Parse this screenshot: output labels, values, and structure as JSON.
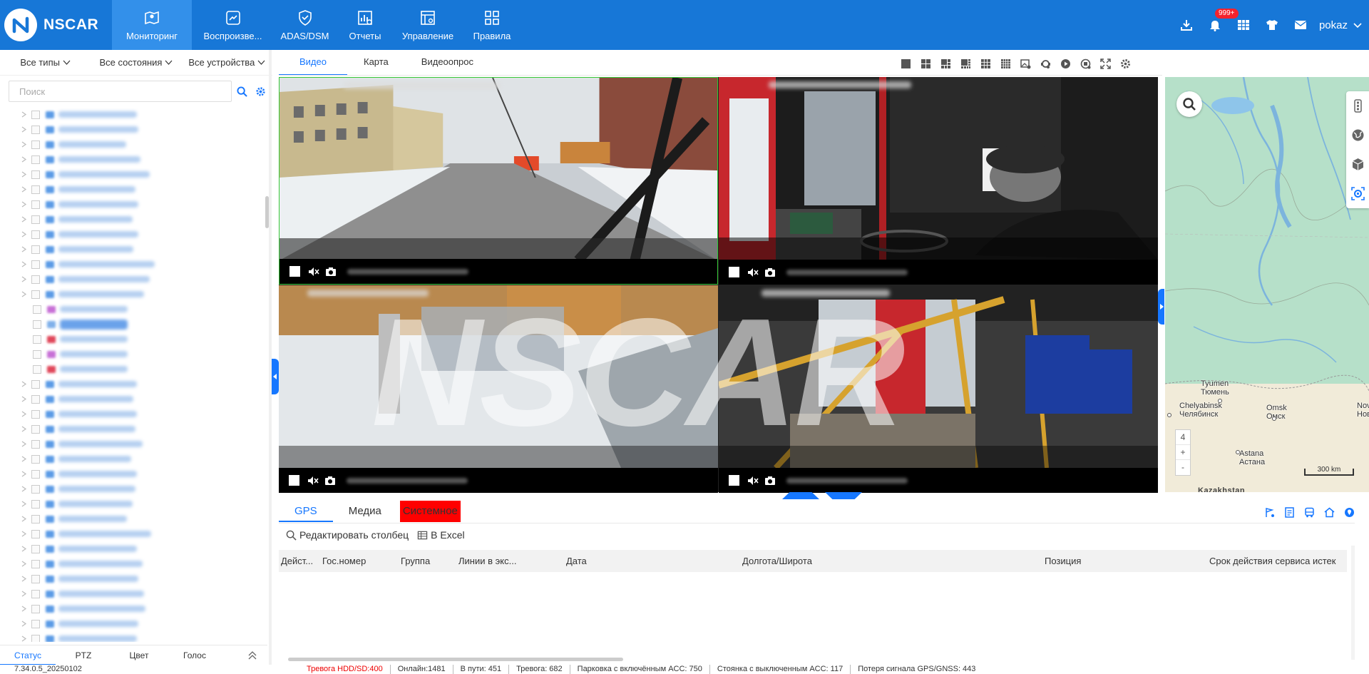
{
  "app": {
    "brand": "NSCAR"
  },
  "nav": [
    {
      "label": "Мониторинг",
      "icon": "map-pin-icon",
      "active": true
    },
    {
      "label": "Воспроизве...",
      "icon": "playback-icon",
      "active": false
    },
    {
      "label": "ADAS/DSM",
      "icon": "shield-check-icon",
      "active": false
    },
    {
      "label": "Отчеты",
      "icon": "report-chart-icon",
      "active": false
    },
    {
      "label": "Управление",
      "icon": "manage-icon",
      "active": false
    },
    {
      "label": "Правила",
      "icon": "rules-grid-icon",
      "active": false
    }
  ],
  "header_tools": {
    "notification_badge": "999+",
    "username": "pokaz"
  },
  "left": {
    "filters": [
      "Все типы",
      "Все состояния",
      "Все устройства"
    ],
    "search_placeholder": "Поиск",
    "tabs": [
      "Статус",
      "PTZ",
      "Цвет",
      "Голос"
    ],
    "active_tab": "Статус"
  },
  "video_tabs": [
    "Видео",
    "Карта",
    "Видеоопрос"
  ],
  "active_video_tab": "Видео",
  "watermark": "NSCAR",
  "map": {
    "cities": [
      {
        "latin": "Tyumen",
        "cyr": "Тюмень"
      },
      {
        "latin": "Chelyabinsk",
        "cyr": "Челябинск"
      },
      {
        "latin": "Omsk",
        "cyr": "Омск"
      },
      {
        "latin": "Astana",
        "cyr": "Астана"
      },
      {
        "latin": "Nov",
        "cyr": "Нов"
      }
    ],
    "zoom_level": "4",
    "zoom_in": "+",
    "zoom_out": "-",
    "scale": "300 km",
    "country": "Kazakhstan"
  },
  "bottom": {
    "tabs": [
      "GPS",
      "Медиа",
      "Системное"
    ],
    "active_tab": "GPS",
    "actions": {
      "edit_columns": "Редактировать столбец",
      "excel": "В Excel"
    },
    "columns": [
      "Дейст...",
      "Гос.номер",
      "Группа",
      "Линии в экс...",
      "Дата",
      "Долгота/Широта",
      "Позиция",
      "Срок действия сервиса истек"
    ]
  },
  "status": {
    "version": "7.34.0.5_20250102",
    "alarm_hdd": "Тревога HDD/SD:400",
    "online": "Онлайн:1481",
    "en_route": "В пути: 451",
    "alarm": "Тревога: 682",
    "parking_acc_on": "Парковка с включённым ACC: 750",
    "parking_acc_off": "Стоянка с выключенным ACC: 117",
    "gps_loss": "Потеря сигнала GPS/GNSS: 443"
  }
}
